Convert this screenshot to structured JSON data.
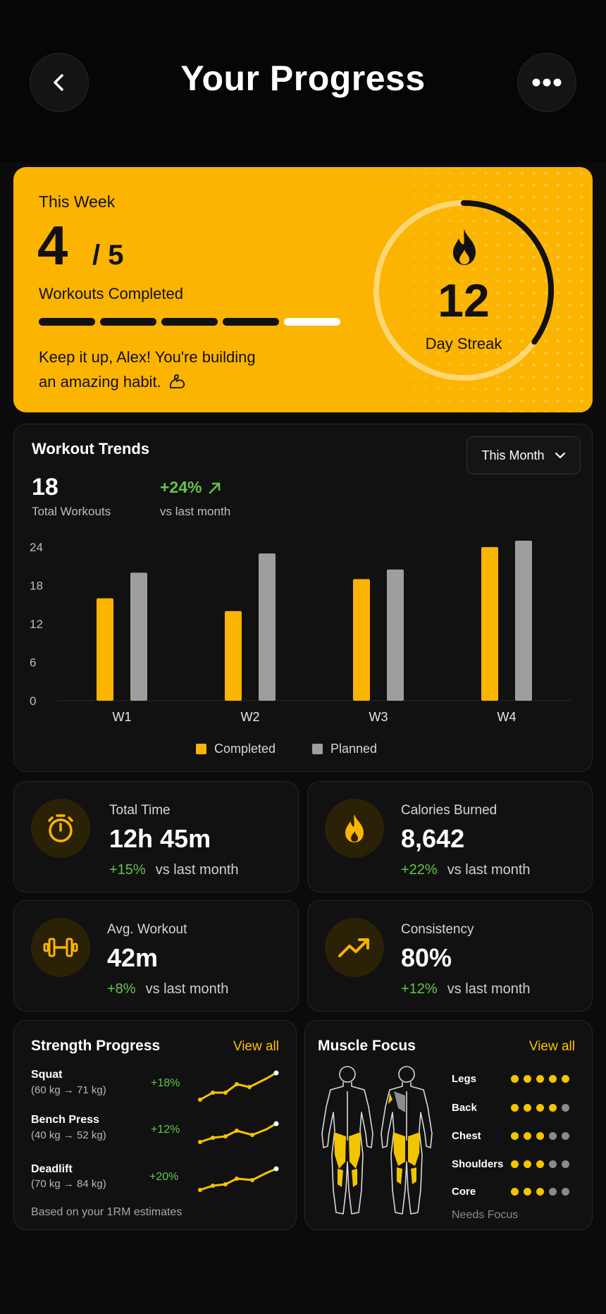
{
  "header": {
    "title": "Your Progress",
    "back_icon": "chevron-left-icon",
    "more_icon": "more-horizontal-icon"
  },
  "weekly": {
    "title": "This Week",
    "completed": "4",
    "total": "/ 5",
    "subtitle": "Workouts Completed",
    "progress_segments": [
      true,
      true,
      true,
      true,
      false
    ],
    "message": "Keep it up, Alex! You're building an amazing habit.",
    "message_icon": "flexed-biceps-icon",
    "streak_value": "12",
    "streak_label": "Day Streak",
    "streak_progress": 0.35,
    "accent": "#fbb400"
  },
  "trends": {
    "title": "Workout Trends",
    "period": "This Month",
    "total_value": "18",
    "total_label": "Total Workouts",
    "change_value": "+24%",
    "change_label": "vs last month"
  },
  "chart_data": {
    "type": "bar",
    "categories": [
      "W1",
      "W2",
      "W3",
      "W4"
    ],
    "series": [
      {
        "name": "Completed",
        "values": [
          16,
          14,
          19,
          24
        ],
        "color": "#fbb400"
      },
      {
        "name": "Planned",
        "values": [
          20,
          23,
          20.5,
          25
        ],
        "color": "#9e9e9e"
      }
    ],
    "yticks": [
      "0",
      "6",
      "12",
      "18",
      "24"
    ],
    "ylim": [
      0,
      25
    ],
    "legend": "bottom-center"
  },
  "stats": [
    {
      "label": "Total Time",
      "value": "12h 45m",
      "change": "+15%",
      "vs": "vs last month",
      "icon": "stopwatch-icon"
    },
    {
      "label": "Calories Burned",
      "value": "8,642",
      "change": "+22%",
      "vs": "vs last month",
      "icon": "flame-icon"
    },
    {
      "label": "Avg. Workout",
      "value": "42m",
      "change": "+8%",
      "vs": "vs last month",
      "icon": "dumbbell-icon"
    },
    {
      "label": "Consistency",
      "value": "80%",
      "change": "+12%",
      "vs": "vs last month",
      "icon": "trend-up-icon"
    }
  ],
  "strength": {
    "title": "Strength Progress",
    "view_all": "View all",
    "lifts": [
      {
        "name": "Squat",
        "range": "(60 kg → 71 kg)",
        "change": "+18%"
      },
      {
        "name": "Bench Press",
        "range": "(40 kg → 52 kg)",
        "change": "+12%"
      },
      {
        "name": "Deadlift",
        "range": "(70 kg → 84 kg)",
        "change": "+20%"
      }
    ],
    "note": "Based on your 1RM estimates"
  },
  "muscle": {
    "title": "Muscle Focus",
    "view_all": "View all",
    "groups": [
      {
        "name": "Legs",
        "level": 5
      },
      {
        "name": "Back",
        "level": 4
      },
      {
        "name": "Chest",
        "level": 3
      },
      {
        "name": "Shoulders",
        "level": 3
      },
      {
        "name": "Core",
        "level": 3
      }
    ],
    "max_level": 5,
    "needs_focus": "Needs Focus"
  }
}
